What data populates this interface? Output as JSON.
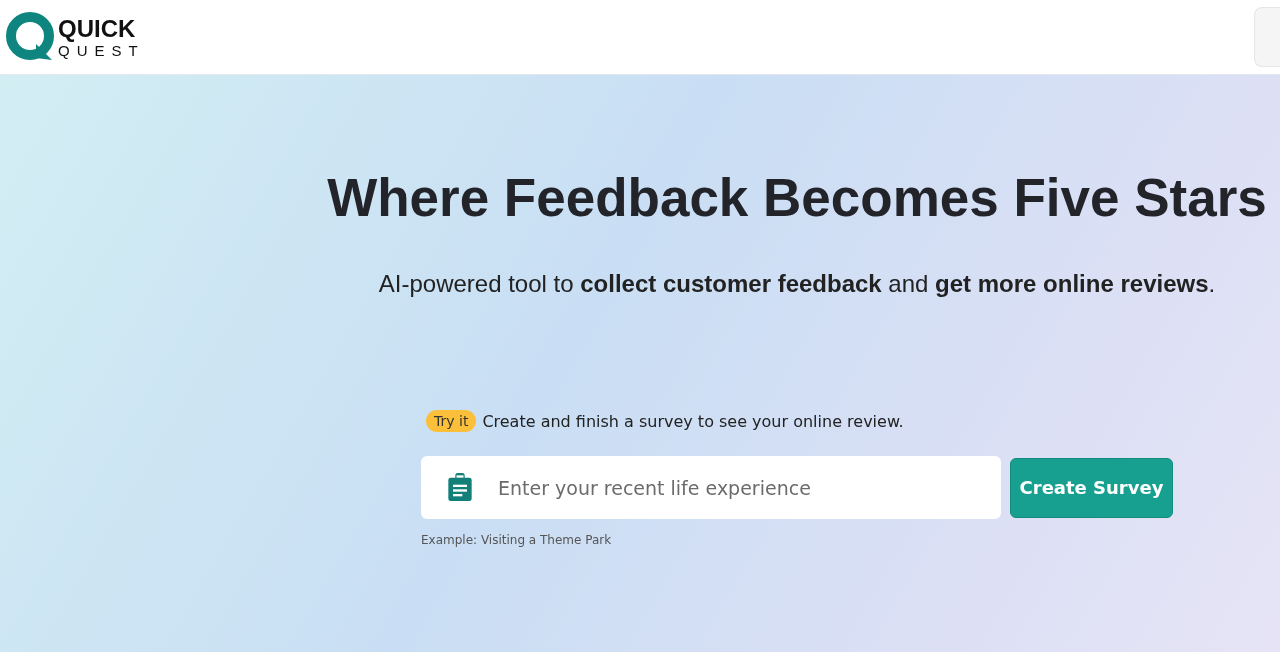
{
  "logo": {
    "line_1": "QUICK",
    "line_2": "QUEST"
  },
  "hero": {
    "title": "Where Feedback Becomes Five Stars",
    "subtitle": "AI-powered tool to **collect customer feedback** and **get more online reviews**."
  },
  "try_it": {
    "badge": "Try it",
    "text": "Create and finish a survey to see your online review."
  },
  "survey_form": {
    "placeholder": "Enter your recent life experience",
    "button": "Create Survey",
    "hint": "Example: Visiting a Theme Park"
  }
}
